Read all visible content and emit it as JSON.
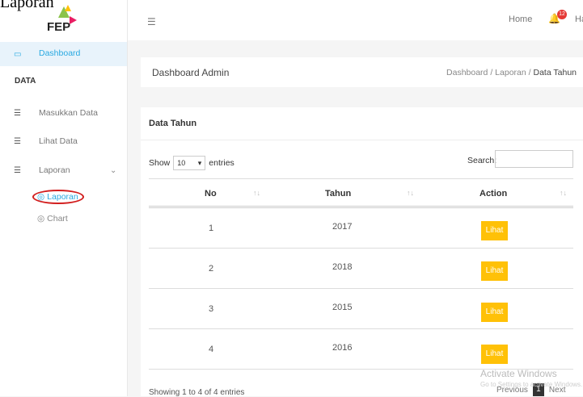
{
  "overlay_caption": "Laporan",
  "brand": {
    "name": "FEP"
  },
  "sidebar": {
    "dashboard": "Dashboard",
    "section": "DATA",
    "items": [
      {
        "label": "Masukkan Data",
        "icon": "list-icon"
      },
      {
        "label": "Lihat Data",
        "icon": "list-icon"
      },
      {
        "label": "Laporan",
        "icon": "list-icon"
      }
    ],
    "subitems": [
      {
        "label": "Laporan",
        "icon": "circle-icon"
      },
      {
        "label": "Chart",
        "icon": "circle-icon"
      }
    ]
  },
  "topbar": {
    "home": "Home",
    "badge": "12",
    "greeting": "Hai, re"
  },
  "header": {
    "title": "Dashboard Admin",
    "breadcrumb": {
      "a": "Dashboard",
      "sep": "/",
      "b": "Laporan",
      "c": "Data Tahun"
    }
  },
  "card": {
    "title": "Data Tahun",
    "show": "Show",
    "entries_value": "10",
    "entries": "entries",
    "search": "Search:",
    "columns": [
      "No",
      "Tahun",
      "Action"
    ],
    "rows": [
      {
        "no": "1",
        "tahun": "2017",
        "action": "Lihat"
      },
      {
        "no": "2",
        "tahun": "2018",
        "action": "Lihat"
      },
      {
        "no": "3",
        "tahun": "2015",
        "action": "Lihat"
      },
      {
        "no": "4",
        "tahun": "2016",
        "action": "Lihat"
      }
    ],
    "info": "Showing 1 to 4 of 4 entries",
    "pager": {
      "prev": "Previous",
      "page": "1",
      "next": "Next"
    }
  },
  "watermark": {
    "line1": "Activate Windows",
    "line2": "Go to Settings to activate Windows."
  },
  "colors": {
    "accent": "#29a9e1",
    "button": "#ffc107",
    "badge": "#e53935",
    "highlight_ring": "#d21e1e"
  }
}
